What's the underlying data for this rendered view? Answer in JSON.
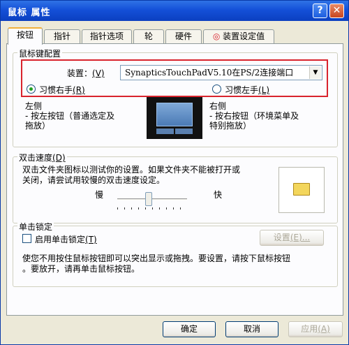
{
  "window": {
    "title": "鼠标 属性",
    "help_glyph": "?",
    "close_glyph": "✕"
  },
  "tabs": [
    {
      "label": "按钮",
      "active": true
    },
    {
      "label": "指针"
    },
    {
      "label": "指针选项"
    },
    {
      "label": "轮"
    },
    {
      "label": "硬件"
    },
    {
      "label": "装置设定值"
    }
  ],
  "button_config": {
    "legend": "鼠标键配置",
    "device_label": "装置：",
    "device_key": "(V)",
    "device_value": "SynapticsTouchPadV5.10在PS/2连接端口",
    "right_hand_label": "习惯右手",
    "right_hand_key": "(R)",
    "left_hand_label": "习惯左手",
    "left_hand_key": "(L)",
    "left_title": "左侧",
    "left_desc_1": "- 按左按钮（普通选定及",
    "left_desc_2": "拖放）",
    "right_title": "右侧",
    "right_desc_1": "- 按右按钮（环境菜单及",
    "right_desc_2": "特别拖放）"
  },
  "double_click": {
    "legend": "双击速度",
    "legend_key": "(D)",
    "desc_1": "双击文件夹图标以测试你的设置。如果文件夹不能被打开或",
    "desc_2": "关闭，请尝试用较慢的双击速度设定。",
    "slow": "慢",
    "fast": "快",
    "speed_fraction": 0.45
  },
  "click_lock": {
    "legend": "单击锁定",
    "enable_label": "启用单击锁定",
    "enable_key": "(T)",
    "settings_label": "设置",
    "settings_key": "(E)...",
    "desc_1": "使您不用按住鼠标按钮即可以突出显示或拖拽。要设置，请按下鼠标按钮",
    "desc_2": "。要放开，请再单击鼠标按钮。"
  },
  "footer": {
    "ok": "确定",
    "cancel": "取消",
    "apply": "应用",
    "apply_key": "(A)"
  },
  "colors": {
    "title_bar": "#1450d8",
    "highlight": "#d9232d",
    "face": "#ece9d8"
  }
}
